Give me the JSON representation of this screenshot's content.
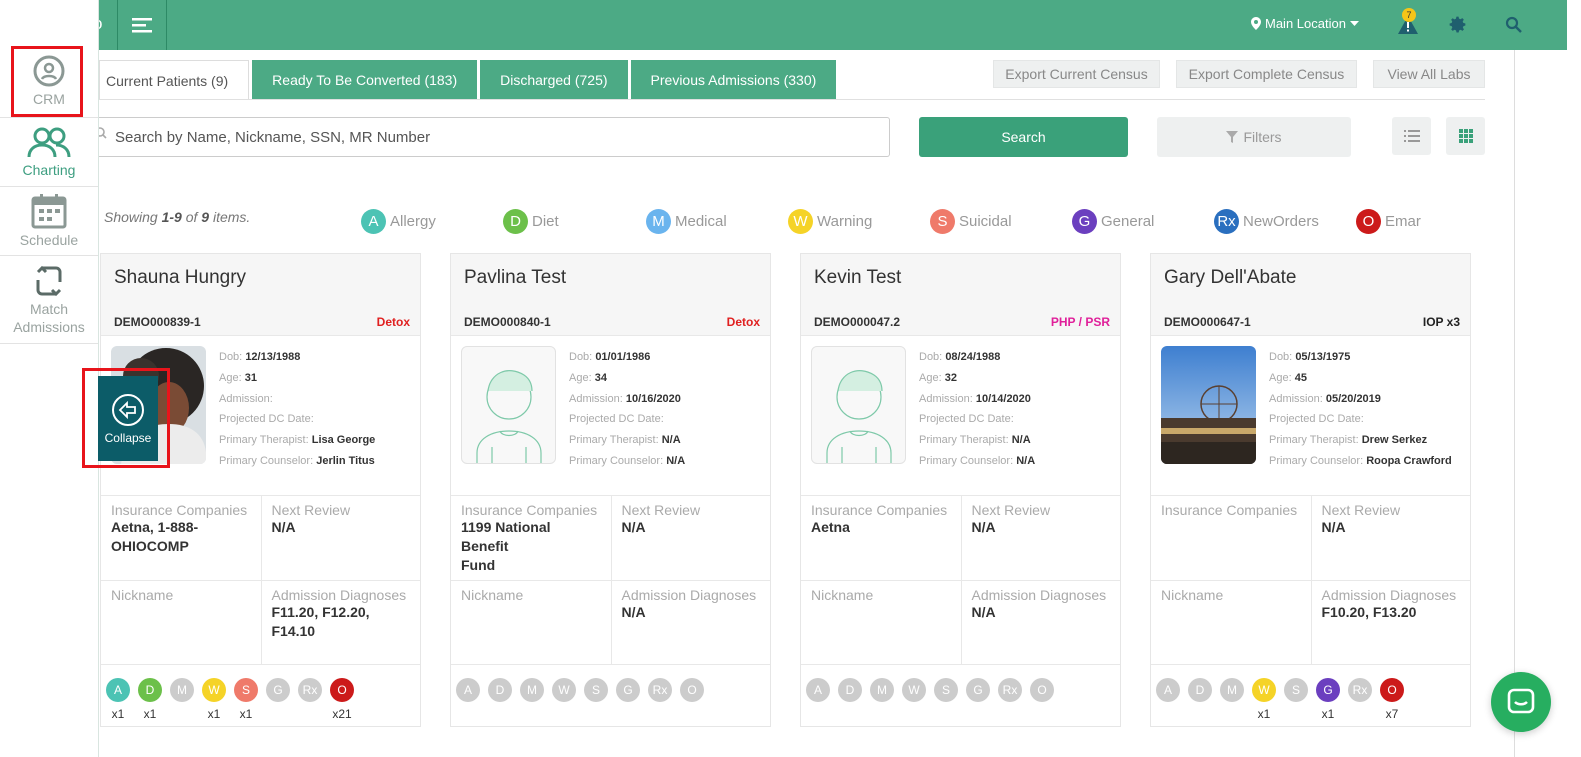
{
  "sidebar": {
    "items": [
      {
        "label": "CRM",
        "icon": "crm-icon"
      },
      {
        "label": "Charting",
        "icon": "users-icon"
      },
      {
        "label": "Schedule",
        "icon": "calendar-icon"
      },
      {
        "label_line1": "Match",
        "label_line2": "Admissions",
        "icon": "refresh-icon"
      }
    ]
  },
  "topbar": {
    "location": "Main Location",
    "alert_count": "7",
    "brand_fragment": "o"
  },
  "tabs": [
    {
      "label": "Current Patients (9)"
    },
    {
      "label": "Ready To Be Converted (183)"
    },
    {
      "label": "Discharged (725)"
    },
    {
      "label": "Previous Admissions (330)"
    }
  ],
  "actions": {
    "export_current": "Export Current Census",
    "export_complete": "Export Complete Census",
    "view_labs": "View All Labs"
  },
  "search": {
    "placeholder": "Search by Name, Nickname, SSN, MR Number",
    "button": "Search",
    "filters": "Filters"
  },
  "summary": {
    "prefix": "Showing ",
    "range": "1-9",
    "middle": " of ",
    "total": "9",
    "suffix": " items."
  },
  "legend": [
    {
      "letter": "A",
      "label": "Allergy",
      "color": "#4cc3b4"
    },
    {
      "letter": "D",
      "label": "Diet",
      "color": "#6cc04a"
    },
    {
      "letter": "M",
      "label": "Medical",
      "color": "#6ab4ee"
    },
    {
      "letter": "W",
      "label": "Warning",
      "color": "#f5d327"
    },
    {
      "letter": "S",
      "label": "Suicidal",
      "color": "#ef7a6a"
    },
    {
      "letter": "G",
      "label": "General",
      "color": "#6b3fbf"
    },
    {
      "letter": "Rx",
      "label": "NewOrders",
      "color": "#2a6fbf"
    },
    {
      "letter": "O",
      "label": "Emar",
      "color": "#cc1a1a"
    }
  ],
  "labels": {
    "dob": "Dob:",
    "age": "Age:",
    "admission": "Admission:",
    "projected": "Projected DC Date:",
    "therapist": "Primary Therapist:",
    "counselor": "Primary Counselor:",
    "insurance": "Insurance Companies",
    "next_review": "Next Review",
    "nickname": "Nickname",
    "diagnoses": "Admission Diagnoses"
  },
  "patients": [
    {
      "name": "Shauna Hungry",
      "mr": "DEMO000839-1",
      "program": "Detox",
      "program_color": "#e02020",
      "dob": "12/13/1988",
      "age": "31",
      "admission": "",
      "projected": "",
      "therapist": "Lisa George",
      "counselor": "Jerlin Titus",
      "insurance_l1": "Aetna, 1-888-",
      "insurance_l2": "OHIOCOMP",
      "next_review": "N/A",
      "nickname": "",
      "diag_l1": "F11.20, F12.20,",
      "diag_l2": "F14.10",
      "counts": [
        "x1",
        "x1",
        "",
        "x1",
        "x1",
        "",
        "",
        "x21"
      ]
    },
    {
      "name": "Pavlina Test",
      "mr": "DEMO000840-1",
      "program": "Detox",
      "program_color": "#e02020",
      "dob": "01/01/1986",
      "age": "34",
      "admission": "10/16/2020",
      "projected": "",
      "therapist": "N/A",
      "counselor": "N/A",
      "insurance_l1": "1199 National Benefit",
      "insurance_l2": "Fund",
      "next_review": "N/A",
      "nickname": "",
      "diag_l1": "N/A",
      "diag_l2": "",
      "counts": [
        "",
        "",
        "",
        "",
        "",
        "",
        "",
        ""
      ]
    },
    {
      "name": "Kevin Test",
      "mr": "DEMO000047.2",
      "program": "PHP / PSR",
      "program_color": "#e0209a",
      "dob": "08/24/1988",
      "age": "32",
      "admission": "10/14/2020",
      "projected": "",
      "therapist": "N/A",
      "counselor": "N/A",
      "insurance_l1": "Aetna",
      "insurance_l2": "",
      "next_review": "N/A",
      "nickname": "",
      "diag_l1": "N/A",
      "diag_l2": "",
      "counts": [
        "",
        "",
        "",
        "",
        "",
        "",
        "",
        ""
      ]
    },
    {
      "name": "Gary Dell'Abate",
      "mr": "DEMO000647-1",
      "program": "IOP x3",
      "program_color": "#222222",
      "dob": "05/13/1975",
      "age": "45",
      "admission": "05/20/2019",
      "projected": "",
      "therapist": "Drew Serkez",
      "counselor": "Roopa Crawford",
      "insurance_l1": "",
      "insurance_l2": "",
      "next_review": "N/A",
      "nickname": "",
      "diag_l1": "F10.20, F13.20",
      "diag_l2": "",
      "counts": [
        "",
        "",
        "",
        "x1",
        "",
        "x1",
        "",
        "x7"
      ]
    }
  ],
  "badge_colors": [
    [
      "#4cc3b4",
      "#6cc04a",
      "#cccccc",
      "#f5d327",
      "#ef7a6a",
      "#cccccc",
      "#cccccc",
      "#cc1a1a"
    ],
    [
      "#cccccc",
      "#cccccc",
      "#cccccc",
      "#cccccc",
      "#cccccc",
      "#cccccc",
      "#cccccc",
      "#cccccc"
    ],
    [
      "#cccccc",
      "#cccccc",
      "#cccccc",
      "#cccccc",
      "#cccccc",
      "#cccccc",
      "#cccccc",
      "#cccccc"
    ],
    [
      "#cccccc",
      "#cccccc",
      "#cccccc",
      "#f5d327",
      "#cccccc",
      "#6b3fbf",
      "#cccccc",
      "#cc1a1a"
    ]
  ],
  "collapse": {
    "label": "Collapse"
  }
}
